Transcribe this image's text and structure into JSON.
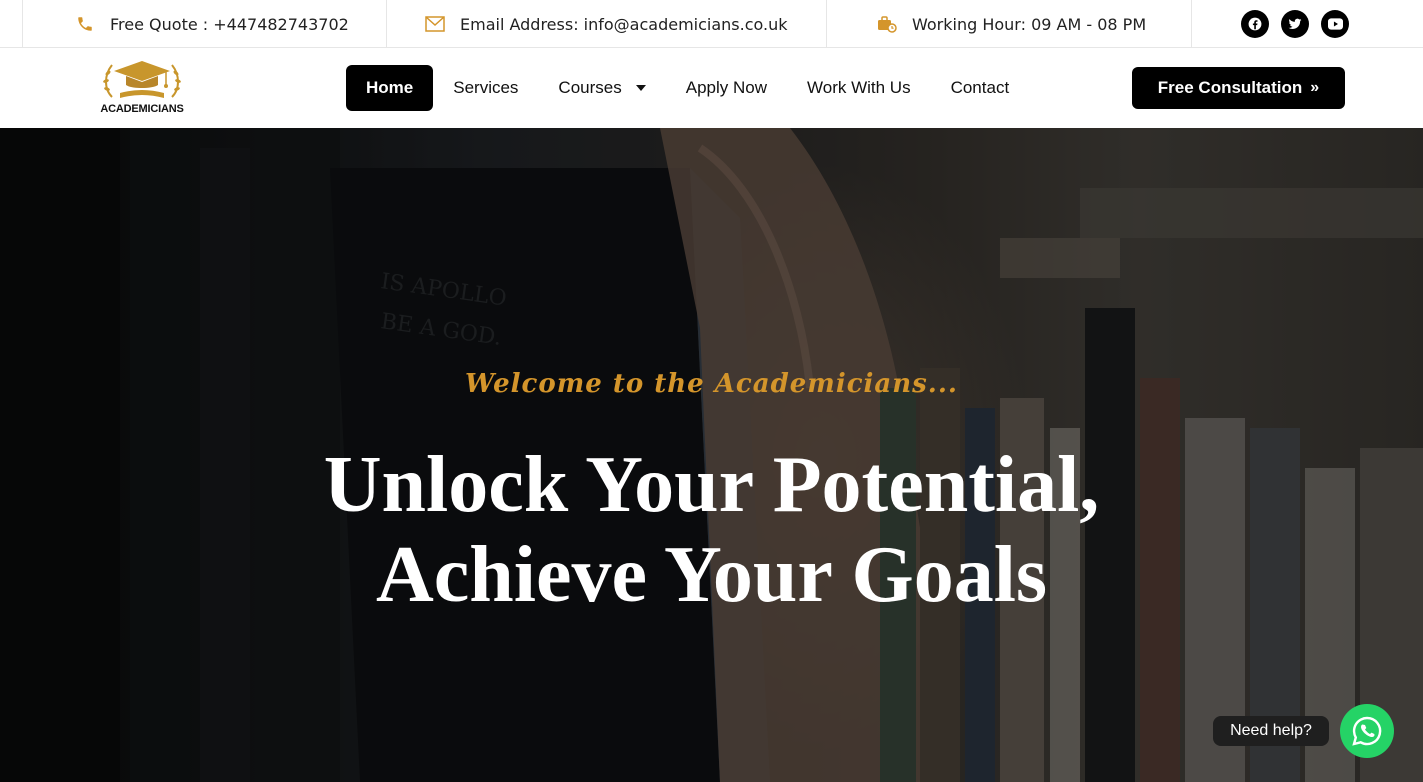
{
  "topbar": {
    "quote": "Free Quote : +447482743702",
    "email": "Email Address: info@academicians.co.uk",
    "hours": "Working Hour: 09 AM - 08 PM",
    "social": [
      "facebook-icon",
      "twitter-icon",
      "youtube-icon"
    ]
  },
  "logo": {
    "text": "ACADEMICIANS"
  },
  "nav": {
    "items": [
      {
        "label": "Home",
        "active": true
      },
      {
        "label": "Services"
      },
      {
        "label": "Courses",
        "has_dropdown": true
      },
      {
        "label": "Apply Now"
      },
      {
        "label": "Work With Us"
      },
      {
        "label": "Contact"
      }
    ],
    "cta": "Free Consultation",
    "cta_chevron": "»"
  },
  "hero": {
    "tagline": "Welcome to the Academicians...",
    "headline_line1": "Unlock Your Potential,",
    "headline_line2": "Achieve Your Goals"
  },
  "help": {
    "label": "Need help?"
  },
  "colors": {
    "accent": "#d4952b",
    "black": "#000000",
    "whatsapp": "#25d366"
  }
}
